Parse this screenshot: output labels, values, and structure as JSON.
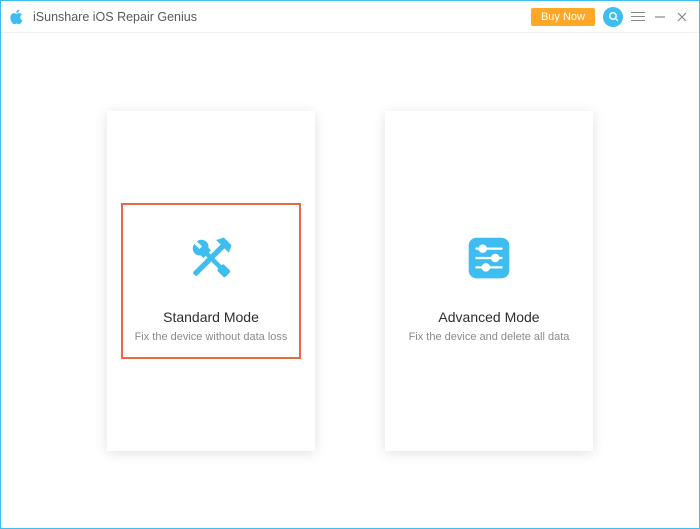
{
  "header": {
    "title": "iSunshare iOS Repair Genius",
    "buy_label": "Buy Now"
  },
  "modes": {
    "standard": {
      "title": "Standard Mode",
      "desc": "Fix the device without data loss"
    },
    "advanced": {
      "title": "Advanced Mode",
      "desc": "Fix the device and delete all data"
    }
  },
  "colors": {
    "accent": "#3EBEF0",
    "highlight": "#E86A3F",
    "buy": "#FFA726"
  }
}
